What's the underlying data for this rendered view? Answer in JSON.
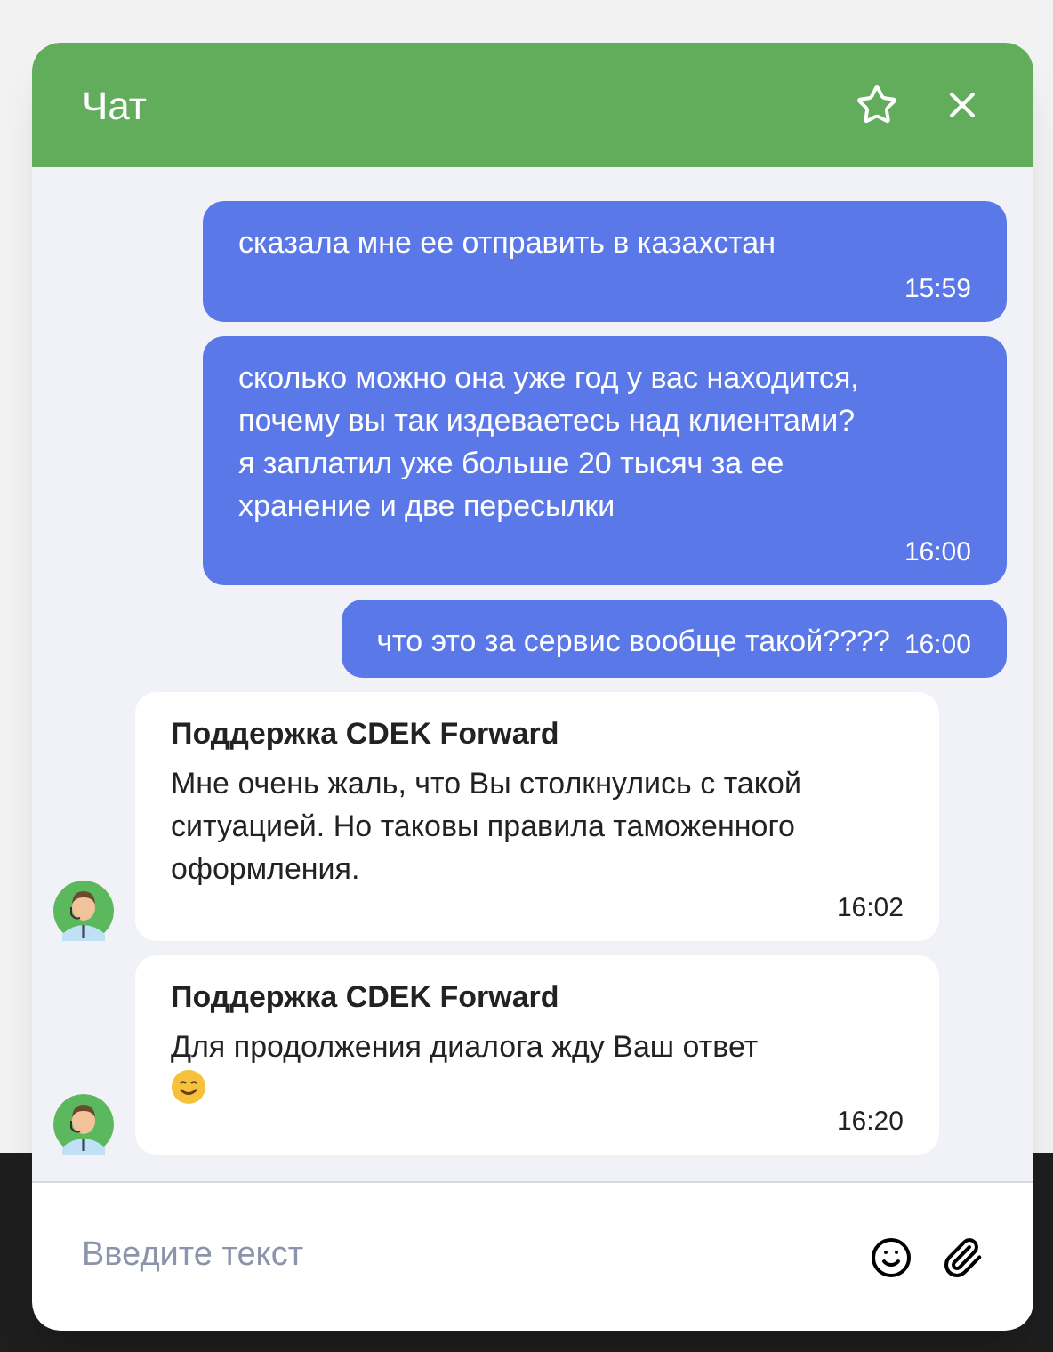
{
  "window": {
    "title": "Чат"
  },
  "messages": [
    {
      "kind": "outgoing",
      "text": "сказала мне ее отправить в казахстан",
      "time": "15:59"
    },
    {
      "kind": "outgoing",
      "text": "сколько можно она уже год у вас находится, почему вы так издеваетесь над клиентами? я заплатил уже больше 20 тысяч за ее хранение и две пересылки",
      "time": "16:00"
    },
    {
      "kind": "outgoing",
      "text": "что это за сервис вообще такой????",
      "time": "16:00"
    },
    {
      "kind": "incoming",
      "sender": "Поддержка CDEK Forward",
      "text": "Мне очень жаль, что Вы столкнулись с такой ситуацией. Но таковы правила таможенного оформления.",
      "time": "16:02",
      "emoji": false
    },
    {
      "kind": "incoming",
      "sender": "Поддержка CDEK Forward",
      "text": "Для продолжения диалога жду Ваш ответ",
      "time": "16:20",
      "emoji": true
    }
  ],
  "input": {
    "placeholder": "Введите текст"
  }
}
